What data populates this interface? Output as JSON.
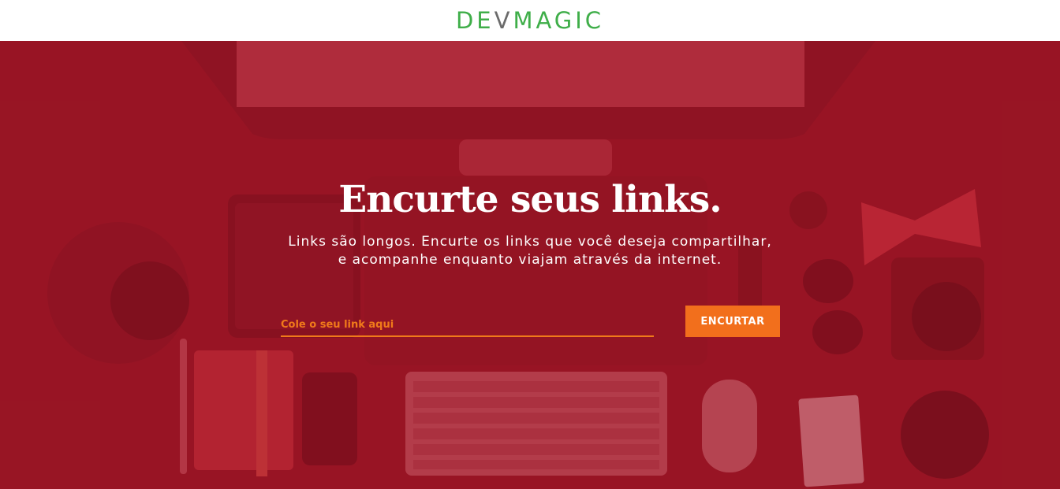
{
  "header": {
    "logo_parts": {
      "dev": "DEV",
      "v": "V",
      "magic": "MAGIC"
    }
  },
  "hero": {
    "title": "Encurte seus links.",
    "subtitle_line1": "Links são longos. Encurte os links que você deseja compartilhar,",
    "subtitle_line2": "e acompanhe enquanto viajam através da internet.",
    "input_placeholder": "Cole o seu link aqui",
    "input_value": "",
    "button_label": "ENCURTAR"
  },
  "colors": {
    "brand_green": "#3fae49",
    "hero_red": "#9e1a28",
    "accent_orange": "#f26f1c"
  }
}
